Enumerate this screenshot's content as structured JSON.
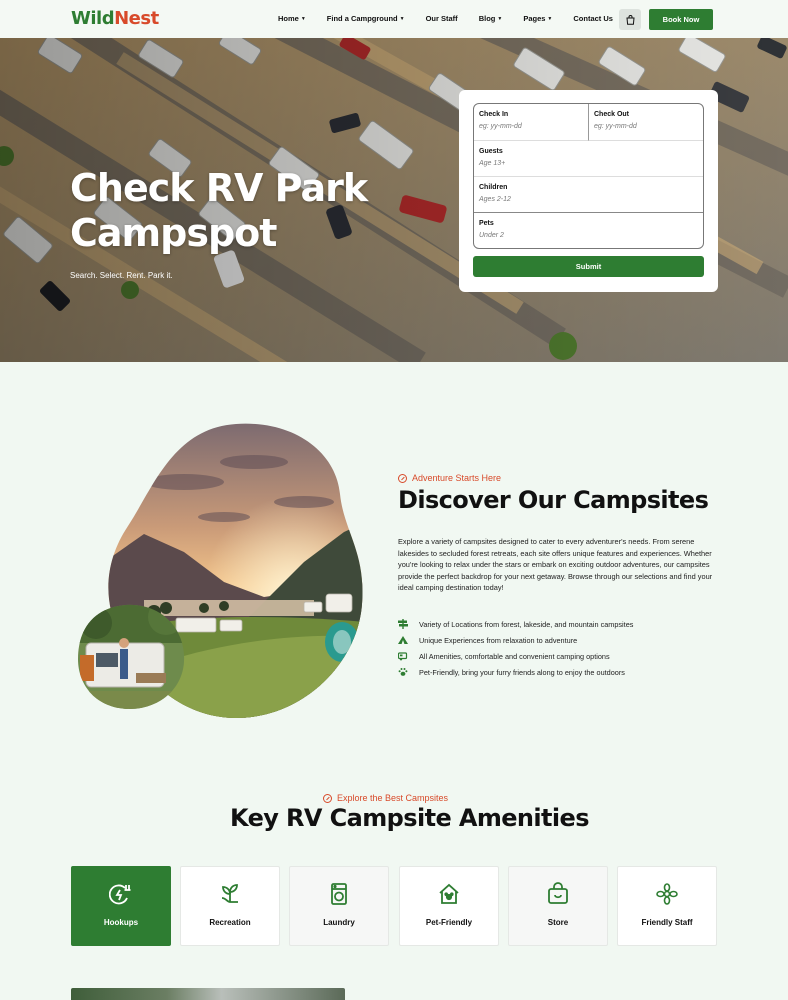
{
  "brand": {
    "part1": "Wild",
    "part2": "Nest"
  },
  "nav": {
    "items": [
      {
        "label": "Home",
        "dropdown": true
      },
      {
        "label": "Find a Campground",
        "dropdown": true
      },
      {
        "label": "Our Staff",
        "dropdown": false
      },
      {
        "label": "Blog",
        "dropdown": true
      },
      {
        "label": "Pages",
        "dropdown": true
      },
      {
        "label": "Contact Us",
        "dropdown": false
      }
    ],
    "book_label": "Book Now",
    "cart_icon": "shopping-bag-icon"
  },
  "hero": {
    "title": "Check RV Park Campspot",
    "subtitle": "Search. Select. Rent. Park it."
  },
  "booking": {
    "check_in": {
      "label": "Check In",
      "placeholder": "eg: yy-mm-dd"
    },
    "check_out": {
      "label": "Check Out",
      "placeholder": "eg: yy-mm-dd"
    },
    "guests": {
      "label": "Guests",
      "placeholder": "Age 13+"
    },
    "children": {
      "label": "Children",
      "placeholder": "Ages 2-12"
    },
    "pets": {
      "label": "Pets",
      "placeholder": "Under 2"
    },
    "submit": "Submit"
  },
  "discover": {
    "tag": "Adventure Starts Here",
    "title": "Discover Our Campsites",
    "description": "Explore a variety of campsites designed to cater to every adventurer's needs. From serene lakesides to secluded forest retreats, each site offers unique features and experiences. Whether you're looking to relax under the stars or embark on exciting outdoor adventures, our campsites provide the perfect backdrop for your next getaway. Browse through our selections and find your ideal camping destination today!",
    "features": [
      {
        "icon": "signpost-icon",
        "text": "Variety of Locations from forest, lakeside, and mountain campsites"
      },
      {
        "icon": "tent-icon",
        "text": "Unique Experiences from relaxation to adventure"
      },
      {
        "icon": "rv-icon",
        "text": "All Amenities, comfortable and convenient camping options"
      },
      {
        "icon": "paw-icon",
        "text": "Pet-Friendly, bring your furry friends along to enjoy the outdoors"
      }
    ]
  },
  "amenities": {
    "tag": "Explore the Best Campsites",
    "title": "Key RV Campsite Amenities",
    "cards": [
      {
        "label": "Hookups",
        "icon": "plug-icon",
        "active": true
      },
      {
        "label": "Recreation",
        "icon": "sprout-icon",
        "active": false
      },
      {
        "label": "Laundry",
        "icon": "washing-machine-icon",
        "active": false
      },
      {
        "label": "Pet-Friendly",
        "icon": "pet-house-icon",
        "active": false
      },
      {
        "label": "Store",
        "icon": "store-bag-icon",
        "active": false
      },
      {
        "label": "Friendly Staff",
        "icon": "flower-icon",
        "active": false
      }
    ]
  },
  "colors": {
    "primary": "#2e7d32",
    "accent": "#d84a2a",
    "background": "#f1f8f2"
  }
}
